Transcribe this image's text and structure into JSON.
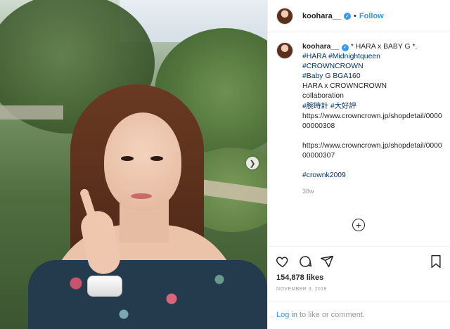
{
  "header": {
    "username": "koohara__",
    "separator": "•",
    "follow_label": "Follow"
  },
  "caption": {
    "username": "koohara__",
    "title": " * HARA x BABY G *.",
    "lines": [
      {
        "text": "#HARA #Midnightqueen",
        "tag": true
      },
      {
        "text": "#CROWNCROWN",
        "tag": true
      },
      {
        "text": "#Baby G BGA160",
        "tag": true
      },
      {
        "text": "HARA x CROWNCROWN",
        "tag": false
      },
      {
        "text": "collaboration",
        "tag": false
      },
      {
        "text": "#腕時計 #大好評",
        "tag": true
      },
      {
        "text": "https://www.crowncrown.jp/shopdetail/000000000308",
        "tag": false
      },
      {
        "text": "",
        "tag": false
      },
      {
        "text": "https://www.crowncrown.jp/shopdetail/000000000307",
        "tag": false
      },
      {
        "text": "",
        "tag": false
      },
      {
        "text": "#crownk2009",
        "tag": true
      }
    ],
    "age": "38w"
  },
  "actions": {
    "likes": "154,878 likes",
    "date": "NOVEMBER 3, 2019",
    "login_link": "Log in",
    "login_rest": " to like or comment."
  },
  "icons": {
    "verified": "verified-badge-icon",
    "carousel": "chevron-right-icon",
    "like": "heart-icon",
    "comment": "comment-icon",
    "share": "share-icon",
    "save": "bookmark-icon",
    "load_more": "plus-circle-icon"
  },
  "colors": {
    "link": "#3897f0",
    "hashtag": "#003569",
    "muted": "#999999"
  }
}
